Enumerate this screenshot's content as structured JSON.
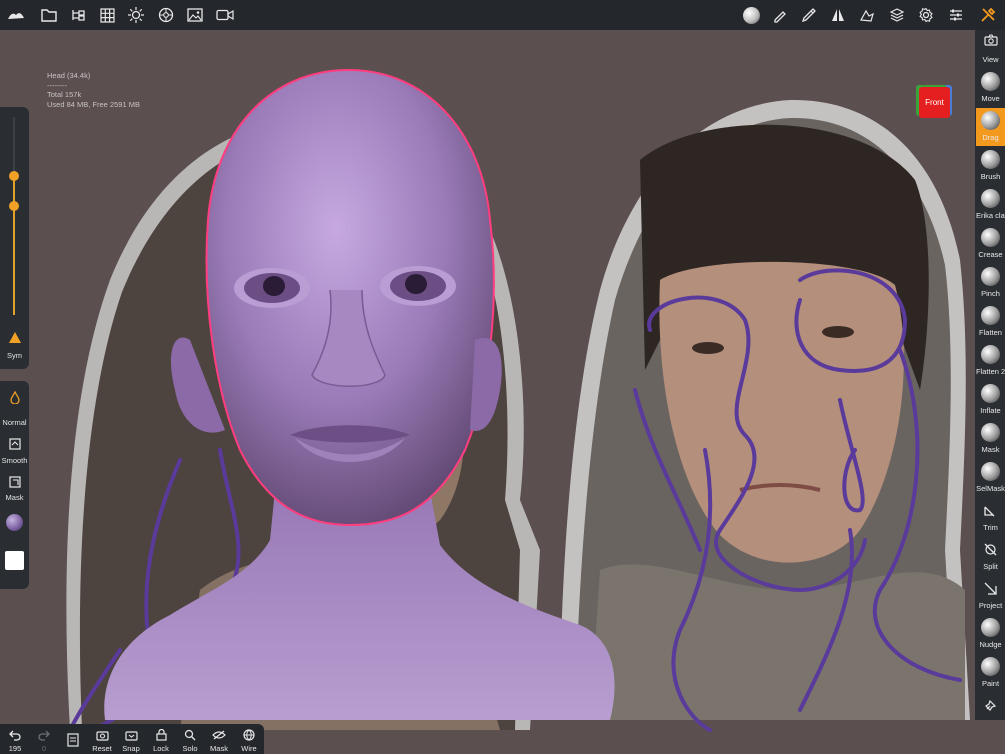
{
  "stats": {
    "object": "Head (34.4k)",
    "separator": "--------",
    "total": "Total 157k",
    "memory": "Used 84 MB,  Free 2591 MB"
  },
  "cube": {
    "face": "Front"
  },
  "left_panel": {
    "sym_label": "Sym",
    "normal_label": "Normal",
    "smooth_label": "Smooth",
    "mask_label": "Mask",
    "slider_radius": 0.7,
    "slider_intensity": 0.55
  },
  "tools": [
    {
      "label": "View",
      "icon": "camera-icon"
    },
    {
      "label": "Move",
      "icon": "move-ball-icon"
    },
    {
      "label": "Drag",
      "icon": "drag-ball-icon",
      "active": true
    },
    {
      "label": "Brush",
      "icon": "brush-ball-icon"
    },
    {
      "label": "Erika clay",
      "icon": "clay-ball-icon"
    },
    {
      "label": "Crease",
      "icon": "crease-ball-icon"
    },
    {
      "label": "Pinch",
      "icon": "pinch-ball-icon"
    },
    {
      "label": "Flatten",
      "icon": "flatten-ball-icon"
    },
    {
      "label": "Flatten 2",
      "icon": "flatten2-ball-icon"
    },
    {
      "label": "Inflate",
      "icon": "inflate-ball-icon"
    },
    {
      "label": "Mask",
      "icon": "mask-ball-icon"
    },
    {
      "label": "SelMask",
      "icon": "selmask-ball-icon"
    },
    {
      "label": "Trim",
      "icon": "trim-icon"
    },
    {
      "label": "Split",
      "icon": "split-icon"
    },
    {
      "label": "Project",
      "icon": "project-icon"
    },
    {
      "label": "Nudge",
      "icon": "nudge-ball-icon"
    },
    {
      "label": "Paint",
      "icon": "paint-ball-icon"
    },
    {
      "label": "",
      "icon": "pin-icon"
    }
  ],
  "bottom": {
    "undo_count": "195",
    "redo_count": "0",
    "items": [
      "Reset",
      "Snap",
      "Lock",
      "Solo",
      "Mask",
      "Wire"
    ]
  },
  "colors": {
    "accent": "#f39a1e",
    "panel": "#2a2e33",
    "sculpt": "#9a7ab7",
    "stroke": "#5a3a9a",
    "mask_outline": "#ff3d7f"
  }
}
